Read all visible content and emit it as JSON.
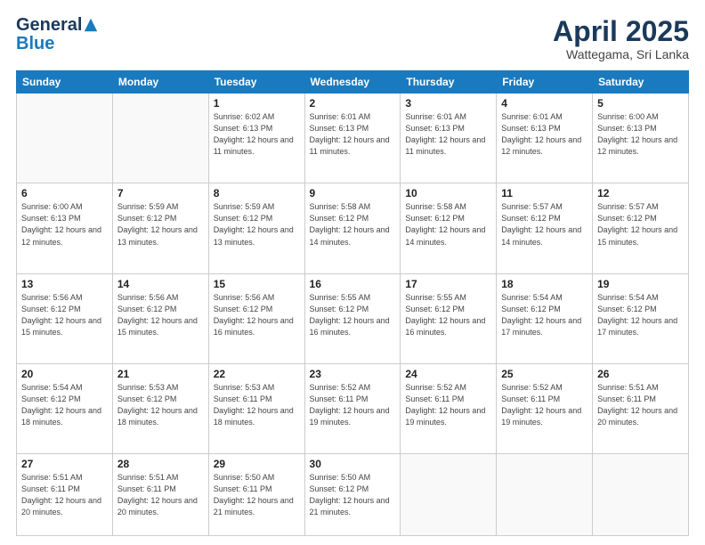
{
  "header": {
    "logo_general": "General",
    "logo_blue": "Blue",
    "month_title": "April 2025",
    "location": "Wattegama, Sri Lanka"
  },
  "weekdays": [
    "Sunday",
    "Monday",
    "Tuesday",
    "Wednesday",
    "Thursday",
    "Friday",
    "Saturday"
  ],
  "weeks": [
    [
      {
        "day": "",
        "info": ""
      },
      {
        "day": "",
        "info": ""
      },
      {
        "day": "1",
        "info": "Sunrise: 6:02 AM\nSunset: 6:13 PM\nDaylight: 12 hours and 11 minutes."
      },
      {
        "day": "2",
        "info": "Sunrise: 6:01 AM\nSunset: 6:13 PM\nDaylight: 12 hours and 11 minutes."
      },
      {
        "day": "3",
        "info": "Sunrise: 6:01 AM\nSunset: 6:13 PM\nDaylight: 12 hours and 11 minutes."
      },
      {
        "day": "4",
        "info": "Sunrise: 6:01 AM\nSunset: 6:13 PM\nDaylight: 12 hours and 12 minutes."
      },
      {
        "day": "5",
        "info": "Sunrise: 6:00 AM\nSunset: 6:13 PM\nDaylight: 12 hours and 12 minutes."
      }
    ],
    [
      {
        "day": "6",
        "info": "Sunrise: 6:00 AM\nSunset: 6:13 PM\nDaylight: 12 hours and 12 minutes."
      },
      {
        "day": "7",
        "info": "Sunrise: 5:59 AM\nSunset: 6:12 PM\nDaylight: 12 hours and 13 minutes."
      },
      {
        "day": "8",
        "info": "Sunrise: 5:59 AM\nSunset: 6:12 PM\nDaylight: 12 hours and 13 minutes."
      },
      {
        "day": "9",
        "info": "Sunrise: 5:58 AM\nSunset: 6:12 PM\nDaylight: 12 hours and 14 minutes."
      },
      {
        "day": "10",
        "info": "Sunrise: 5:58 AM\nSunset: 6:12 PM\nDaylight: 12 hours and 14 minutes."
      },
      {
        "day": "11",
        "info": "Sunrise: 5:57 AM\nSunset: 6:12 PM\nDaylight: 12 hours and 14 minutes."
      },
      {
        "day": "12",
        "info": "Sunrise: 5:57 AM\nSunset: 6:12 PM\nDaylight: 12 hours and 15 minutes."
      }
    ],
    [
      {
        "day": "13",
        "info": "Sunrise: 5:56 AM\nSunset: 6:12 PM\nDaylight: 12 hours and 15 minutes."
      },
      {
        "day": "14",
        "info": "Sunrise: 5:56 AM\nSunset: 6:12 PM\nDaylight: 12 hours and 15 minutes."
      },
      {
        "day": "15",
        "info": "Sunrise: 5:56 AM\nSunset: 6:12 PM\nDaylight: 12 hours and 16 minutes."
      },
      {
        "day": "16",
        "info": "Sunrise: 5:55 AM\nSunset: 6:12 PM\nDaylight: 12 hours and 16 minutes."
      },
      {
        "day": "17",
        "info": "Sunrise: 5:55 AM\nSunset: 6:12 PM\nDaylight: 12 hours and 16 minutes."
      },
      {
        "day": "18",
        "info": "Sunrise: 5:54 AM\nSunset: 6:12 PM\nDaylight: 12 hours and 17 minutes."
      },
      {
        "day": "19",
        "info": "Sunrise: 5:54 AM\nSunset: 6:12 PM\nDaylight: 12 hours and 17 minutes."
      }
    ],
    [
      {
        "day": "20",
        "info": "Sunrise: 5:54 AM\nSunset: 6:12 PM\nDaylight: 12 hours and 18 minutes."
      },
      {
        "day": "21",
        "info": "Sunrise: 5:53 AM\nSunset: 6:12 PM\nDaylight: 12 hours and 18 minutes."
      },
      {
        "day": "22",
        "info": "Sunrise: 5:53 AM\nSunset: 6:11 PM\nDaylight: 12 hours and 18 minutes."
      },
      {
        "day": "23",
        "info": "Sunrise: 5:52 AM\nSunset: 6:11 PM\nDaylight: 12 hours and 19 minutes."
      },
      {
        "day": "24",
        "info": "Sunrise: 5:52 AM\nSunset: 6:11 PM\nDaylight: 12 hours and 19 minutes."
      },
      {
        "day": "25",
        "info": "Sunrise: 5:52 AM\nSunset: 6:11 PM\nDaylight: 12 hours and 19 minutes."
      },
      {
        "day": "26",
        "info": "Sunrise: 5:51 AM\nSunset: 6:11 PM\nDaylight: 12 hours and 20 minutes."
      }
    ],
    [
      {
        "day": "27",
        "info": "Sunrise: 5:51 AM\nSunset: 6:11 PM\nDaylight: 12 hours and 20 minutes."
      },
      {
        "day": "28",
        "info": "Sunrise: 5:51 AM\nSunset: 6:11 PM\nDaylight: 12 hours and 20 minutes."
      },
      {
        "day": "29",
        "info": "Sunrise: 5:50 AM\nSunset: 6:11 PM\nDaylight: 12 hours and 21 minutes."
      },
      {
        "day": "30",
        "info": "Sunrise: 5:50 AM\nSunset: 6:12 PM\nDaylight: 12 hours and 21 minutes."
      },
      {
        "day": "",
        "info": ""
      },
      {
        "day": "",
        "info": ""
      },
      {
        "day": "",
        "info": ""
      }
    ]
  ]
}
